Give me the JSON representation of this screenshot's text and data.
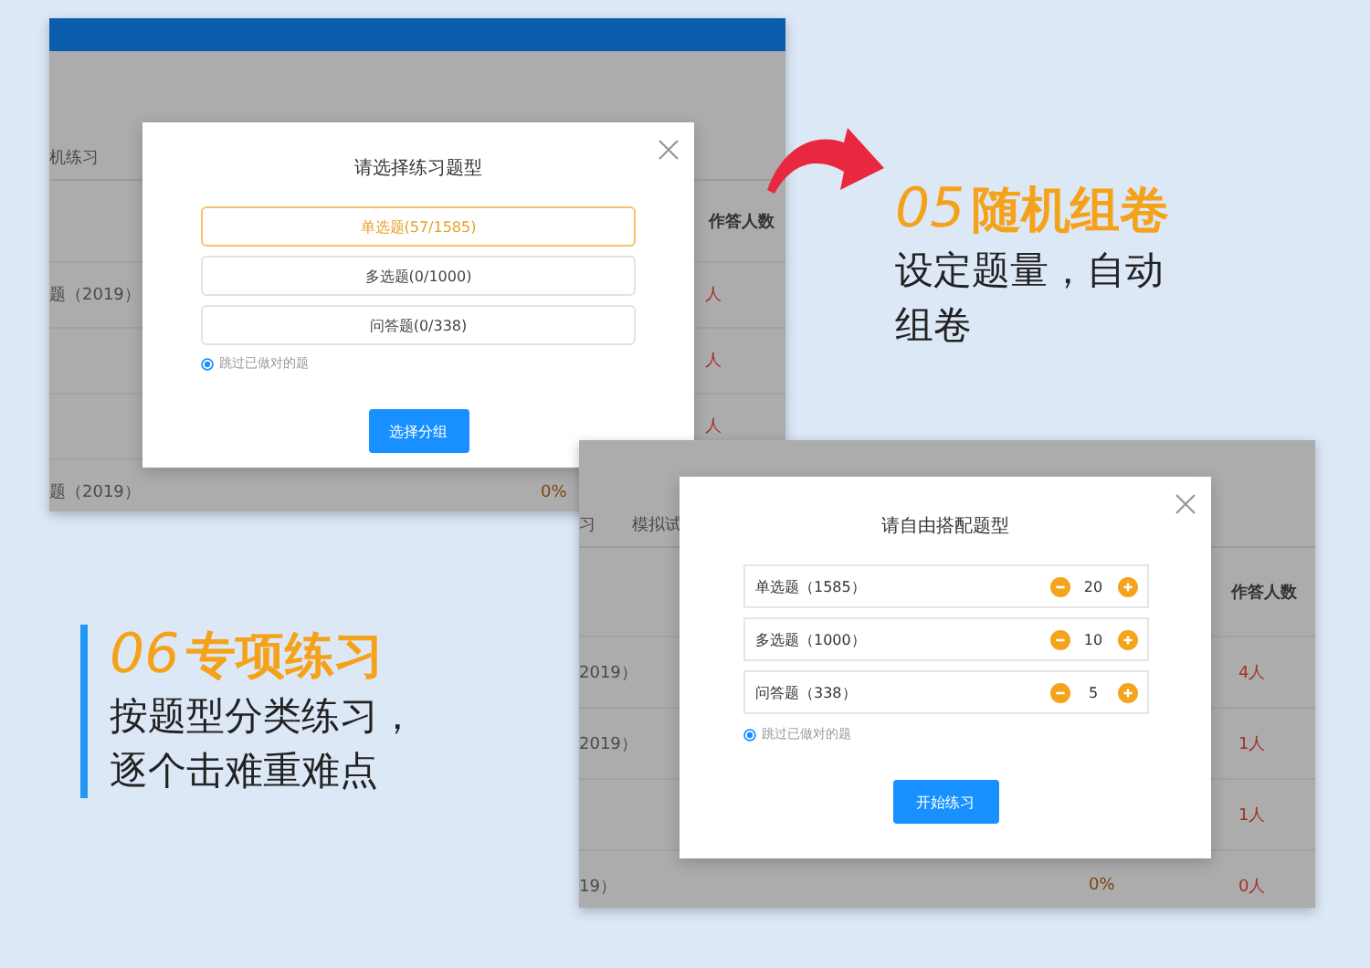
{
  "screen_1": {
    "background": {
      "tabs": [
        "机练习"
      ],
      "column_header": "作答人数",
      "rows": [
        {
          "title": "题（2019）",
          "rate": "",
          "count": "人"
        },
        {
          "title": "",
          "rate": "",
          "count": "人"
        },
        {
          "title": "",
          "rate": "",
          "count": "人"
        },
        {
          "title": "题（2019）",
          "rate": "0%",
          "count": ""
        }
      ]
    },
    "dialog": {
      "title": "请选择练习题型",
      "options": [
        {
          "label": "单选题(57/1585)",
          "selected": true
        },
        {
          "label": "多选题(0/1000)",
          "selected": false
        },
        {
          "label": "问答题(0/338)",
          "selected": false
        }
      ],
      "skip_option": {
        "label": "跳过已做对的题",
        "checked": true
      },
      "button": "选择分组"
    }
  },
  "feature_05": {
    "number": "05",
    "title": "随机组卷",
    "lines": [
      "设定题量，自动",
      "组卷"
    ]
  },
  "screen_2": {
    "background": {
      "tabs": [
        "习",
        "模拟试"
      ],
      "column_header": "作答人数",
      "rows": [
        {
          "title": "2019）",
          "rate": "",
          "count": "4人"
        },
        {
          "title": "2019）",
          "rate": "",
          "count": "1人"
        },
        {
          "title": "",
          "rate": "",
          "count": "1人"
        },
        {
          "title": "19）",
          "rate": "0%",
          "count": "0人"
        }
      ]
    },
    "dialog": {
      "title": "请自由搭配题型",
      "items": [
        {
          "label": "单选题（1585）",
          "value": "20"
        },
        {
          "label": "多选题（1000）",
          "value": "10"
        },
        {
          "label": "问答题（338）",
          "value": "5"
        }
      ],
      "skip_option": {
        "label": "跳过已做对的题",
        "checked": true
      },
      "button": "开始练习"
    }
  },
  "feature_06": {
    "number": "06",
    "title": "专项练习",
    "lines": [
      "按题型分类练习，",
      "逐个击难重难点"
    ]
  }
}
